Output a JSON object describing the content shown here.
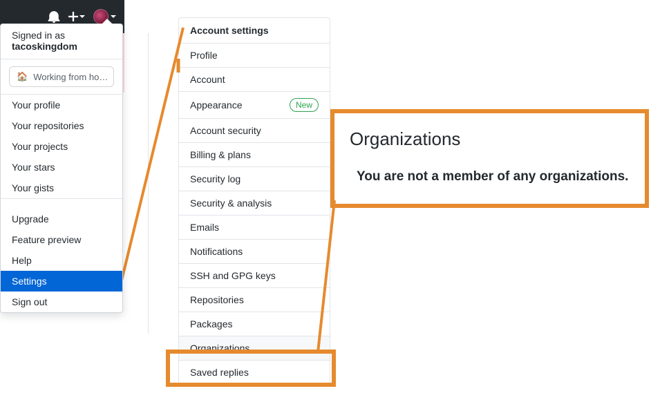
{
  "topbar": {
    "notif_aria": "Notifications",
    "add_aria": "Create new"
  },
  "dropdown": {
    "signed_in_as": "Signed in as",
    "username": "tacoskingdom",
    "status_emoji": "🏠",
    "status_text": "Working from ho…",
    "items_a": [
      "Your profile",
      "Your repositories",
      "Your projects",
      "Your stars",
      "Your gists"
    ],
    "items_b": [
      "Upgrade",
      "Feature preview",
      "Help",
      "Settings",
      "Sign out"
    ],
    "selected": "Settings"
  },
  "sidebar": {
    "header": "Account settings",
    "items": [
      {
        "label": "Profile"
      },
      {
        "label": "Account"
      },
      {
        "label": "Appearance",
        "new": true
      },
      {
        "label": "Account security"
      },
      {
        "label": "Billing & plans"
      },
      {
        "label": "Security log"
      },
      {
        "label": "Security & analysis"
      },
      {
        "label": "Emails"
      },
      {
        "label": "Notifications"
      },
      {
        "label": "SSH and GPG keys"
      },
      {
        "label": "Repositories"
      },
      {
        "label": "Packages"
      },
      {
        "label": "Organizations",
        "active": true
      },
      {
        "label": "Saved replies"
      }
    ],
    "new_badge": "New"
  },
  "main": {
    "title": "Organizations",
    "message": "You are not a member of any organizations."
  }
}
